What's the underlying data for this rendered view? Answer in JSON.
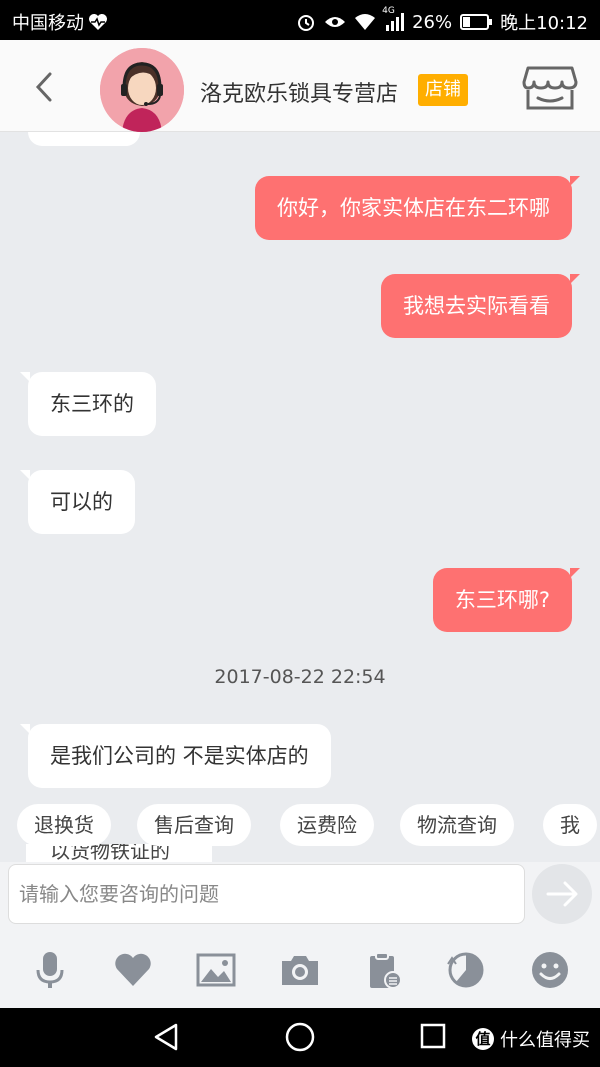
{
  "status_bar": {
    "carrier": "中国移动",
    "network": "4G",
    "battery": "26%",
    "time": "晚上10:12"
  },
  "header": {
    "shop_name": "洛克欧乐锁具专营店",
    "shop_badge": "店铺"
  },
  "messages": [
    {
      "side": "out",
      "text": "你好，你家实体店在东二环哪"
    },
    {
      "side": "out",
      "text": "我想去实际看看"
    },
    {
      "side": "in",
      "text": "东三环的"
    },
    {
      "side": "in",
      "text": "可以的"
    },
    {
      "side": "out",
      "text": "东三环哪?"
    },
    {
      "side": "in",
      "text": "是我们公司的 不是实体店的"
    }
  ],
  "timestamp": "2017-08-22 22:54",
  "quick_replies": [
    "退换货",
    "售后查询",
    "运费险",
    "物流查询",
    "我"
  ],
  "partial_text": "以货物铁证的",
  "input": {
    "placeholder": "请输入您要咨询的问题"
  },
  "toolbar_icons": [
    "microphone-icon",
    "heart-icon",
    "image-icon",
    "camera-icon",
    "clipboard-icon",
    "history-icon",
    "emoji-icon"
  ],
  "watermark": {
    "logo": "值",
    "text": "什么值得买"
  },
  "colors": {
    "outgoing_bubble": "#fe7171",
    "incoming_bubble": "#ffffff",
    "badge": "#ffae00",
    "chat_background": "#eaecef"
  }
}
